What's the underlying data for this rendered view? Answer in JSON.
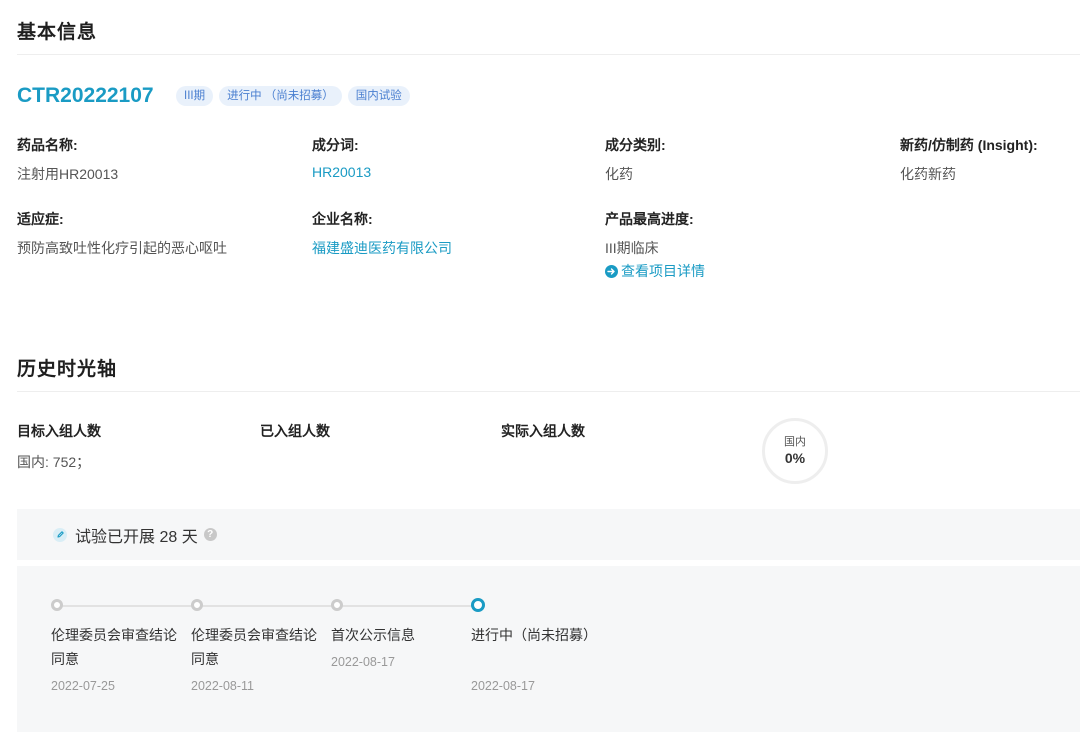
{
  "basic_info": {
    "title": "基本信息",
    "trial_id": "CTR20222107",
    "tags": [
      "III期",
      "进行中 （尚未招募）",
      "国内试验"
    ],
    "fields": {
      "drug_name": {
        "label": "药品名称:",
        "value": "注射用HR20013"
      },
      "ingredient": {
        "label": "成分词:",
        "value": "HR20013"
      },
      "ingredient_type": {
        "label": "成分类别:",
        "value": "化药"
      },
      "new_generic": {
        "label": "新药/仿制药 (Insight):",
        "value": "化药新药"
      },
      "indication": {
        "label": "适应症:",
        "value": "预防高致吐性化疗引起的恶心呕吐"
      },
      "company": {
        "label": "企业名称:",
        "value": "福建盛迪医药有限公司"
      },
      "max_progress": {
        "label": "产品最高进度:",
        "value": "III期临床"
      }
    },
    "project_detail_link": "查看项目详情"
  },
  "history": {
    "title": "历史时光轴",
    "target_enrollment": {
      "label": "目标入组人数",
      "value": "国内: 752；"
    },
    "enrolled": {
      "label": "已入组人数"
    },
    "actual_enrollment": {
      "label": "实际入组人数"
    },
    "gauge": {
      "label": "国内",
      "value": "0%",
      "fraction": 0
    },
    "duration_text": "试验已开展 28 天",
    "help_icon_glyph": "?",
    "timeline": [
      {
        "title": "伦理委员会审查结论同意",
        "date": "2022-07-25",
        "active": false
      },
      {
        "title": "伦理委员会审查结论同意",
        "date": "2022-08-11",
        "active": false
      },
      {
        "title": "首次公示信息",
        "date": "2022-08-17",
        "active": false
      },
      {
        "title": "进行中（尚未招募）",
        "date": "2022-08-17",
        "active": true
      }
    ]
  },
  "colors": {
    "accent": "#1a9bc4",
    "tag_bg": "#e9f1fb",
    "tag_text": "#4a7fd0",
    "panel_bg": "#f6f7f8"
  },
  "icons": {
    "detail_link": "arrow-circle-icon",
    "duration": "pencil-icon",
    "help": "question-icon"
  }
}
